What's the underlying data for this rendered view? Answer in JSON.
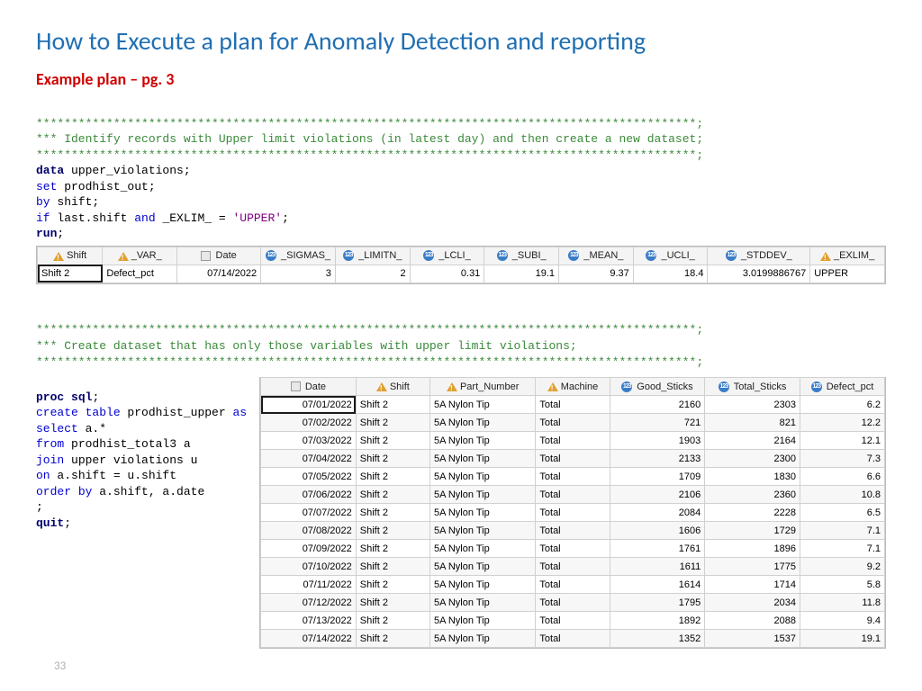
{
  "title": "How to Execute a plan for Anomaly Detection and reporting",
  "subtitle": "Example plan – pg. 3",
  "page_number": "33",
  "code_block_1": {
    "star_line": "**********************************************************************************************;",
    "comment": "*** Identify records with Upper limit violations (in latest day) and then create a new dataset;",
    "l1_kw": "data",
    "l1_rest": " upper_violations;",
    "l2_kw": "set",
    "l2_rest": " prodhist_out;",
    "l3_kw": "by",
    "l3_rest": " shift;",
    "l4_kw": "if",
    "l4_a": " last.shift ",
    "l4_and": "and",
    "l4_b": " _EXLIM_ = ",
    "l4_lit": "'UPPER'",
    "l4_sc": ";",
    "l5_kw": "run",
    "l5_sc": ";"
  },
  "table1": {
    "headers": [
      "Shift",
      "_VAR_",
      "Date",
      "_SIGMAS_",
      "_LIMITN_",
      "_LCLI_",
      "_SUBI_",
      "_MEAN_",
      "_UCLI_",
      "_STDDEV_",
      "_EXLIM_"
    ],
    "row": {
      "shift": "Shift 2",
      "var": "Defect_pct",
      "date": "07/14/2022",
      "sigmas": "3",
      "limitn": "2",
      "lcli": "0.31",
      "subi": "19.1",
      "mean": "9.37",
      "ucli": "18.4",
      "stddev": "3.0199886767",
      "exlim": "UPPER"
    }
  },
  "code_block_2": {
    "star_line": "**********************************************************************************************;",
    "comment": "*** Create dataset that has only those variables with upper limit violations;",
    "l1a": "proc",
    "l1b": " sql",
    "l1sc": ";",
    "l2a": "create",
    "l2b": " table",
    "l2c": " prodhist_upper ",
    "l2d": "as",
    "l3a": "select",
    "l3b": " a.*",
    "l4a": "from",
    "l4b": " prodhist_total3 a",
    "l5a": "join",
    "l5b": " upper violations u",
    "l6a": "on",
    "l6b": " a.shift = u.shift",
    "l7a": "order",
    "l7b": " by",
    "l7c": " a.shift, a.date",
    "l8": ";",
    "l9a": "quit",
    "l9sc": ";"
  },
  "table2": {
    "headers": [
      "Date",
      "Shift",
      "Part_Number",
      "Machine",
      "Good_Sticks",
      "Total_Sticks",
      "Defect_pct"
    ],
    "rows": [
      {
        "date": "07/01/2022",
        "shift": "Shift 2",
        "part": "5A Nylon Tip",
        "mach": "Total",
        "good": "2160",
        "total": "2303",
        "def": "6.2"
      },
      {
        "date": "07/02/2022",
        "shift": "Shift 2",
        "part": "5A Nylon Tip",
        "mach": "Total",
        "good": "721",
        "total": "821",
        "def": "12.2"
      },
      {
        "date": "07/03/2022",
        "shift": "Shift 2",
        "part": "5A Nylon Tip",
        "mach": "Total",
        "good": "1903",
        "total": "2164",
        "def": "12.1"
      },
      {
        "date": "07/04/2022",
        "shift": "Shift 2",
        "part": "5A Nylon Tip",
        "mach": "Total",
        "good": "2133",
        "total": "2300",
        "def": "7.3"
      },
      {
        "date": "07/05/2022",
        "shift": "Shift 2",
        "part": "5A Nylon Tip",
        "mach": "Total",
        "good": "1709",
        "total": "1830",
        "def": "6.6"
      },
      {
        "date": "07/06/2022",
        "shift": "Shift 2",
        "part": "5A Nylon Tip",
        "mach": "Total",
        "good": "2106",
        "total": "2360",
        "def": "10.8"
      },
      {
        "date": "07/07/2022",
        "shift": "Shift 2",
        "part": "5A Nylon Tip",
        "mach": "Total",
        "good": "2084",
        "total": "2228",
        "def": "6.5"
      },
      {
        "date": "07/08/2022",
        "shift": "Shift 2",
        "part": "5A Nylon Tip",
        "mach": "Total",
        "good": "1606",
        "total": "1729",
        "def": "7.1"
      },
      {
        "date": "07/09/2022",
        "shift": "Shift 2",
        "part": "5A Nylon Tip",
        "mach": "Total",
        "good": "1761",
        "total": "1896",
        "def": "7.1"
      },
      {
        "date": "07/10/2022",
        "shift": "Shift 2",
        "part": "5A Nylon Tip",
        "mach": "Total",
        "good": "1611",
        "total": "1775",
        "def": "9.2"
      },
      {
        "date": "07/11/2022",
        "shift": "Shift 2",
        "part": "5A Nylon Tip",
        "mach": "Total",
        "good": "1614",
        "total": "1714",
        "def": "5.8"
      },
      {
        "date": "07/12/2022",
        "shift": "Shift 2",
        "part": "5A Nylon Tip",
        "mach": "Total",
        "good": "1795",
        "total": "2034",
        "def": "11.8"
      },
      {
        "date": "07/13/2022",
        "shift": "Shift 2",
        "part": "5A Nylon Tip",
        "mach": "Total",
        "good": "1892",
        "total": "2088",
        "def": "9.4"
      },
      {
        "date": "07/14/2022",
        "shift": "Shift 2",
        "part": "5A Nylon Tip",
        "mach": "Total",
        "good": "1352",
        "total": "1537",
        "def": "19.1"
      }
    ]
  }
}
